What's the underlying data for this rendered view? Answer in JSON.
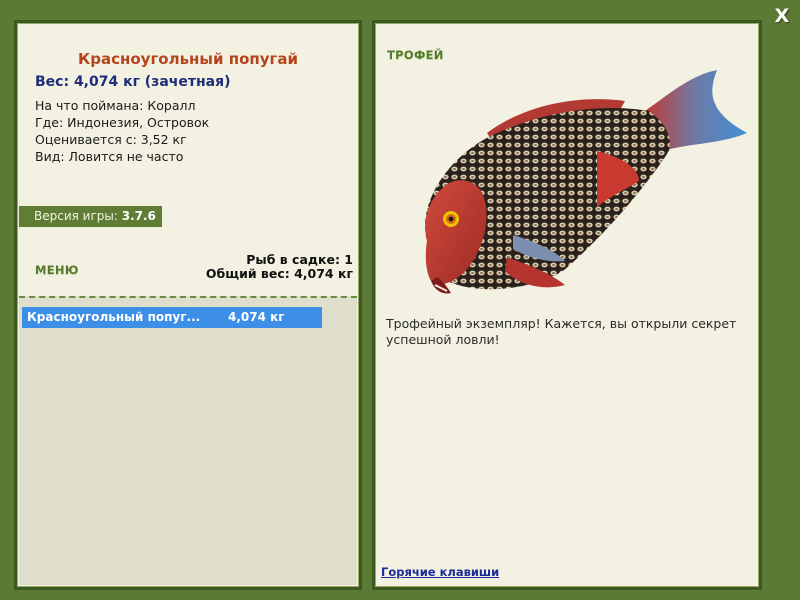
{
  "close": {
    "label": "X"
  },
  "fish": {
    "name": "Красноугольный попугай",
    "weight_line": "Вес: 4,074 кг (зачетная)",
    "details": [
      "На что поймана: Коралл",
      "Где: Индонезия, Островок",
      "Оценивается с: 3,52 кг",
      "Вид: Ловится не часто"
    ]
  },
  "version": {
    "label": "Версия игры:",
    "value": "3.7.6"
  },
  "menu": {
    "label": "МЕНЮ"
  },
  "keep": {
    "count_line": "Рыб в садке: 1",
    "total_line": "Общий вес: 4,074 кг"
  },
  "catch_list": [
    {
      "name": "Красноугольный попуг...",
      "weight": "4,074 кг"
    }
  ],
  "trophy": {
    "label": "ТРОФЕЙ",
    "text": "Трофейный экземпляр! Кажется, вы открыли секрет успешной ловли!",
    "image_icon": "parrotfish-image"
  },
  "hotkeys": {
    "label": "Горячие клавиши"
  },
  "colors": {
    "frame": "#5b7a34",
    "panel": "#f3f1e1",
    "title": "#b5441d",
    "weight": "#1f2d7a",
    "selection": "#3d8ee6",
    "section_label": "#557a2c"
  }
}
